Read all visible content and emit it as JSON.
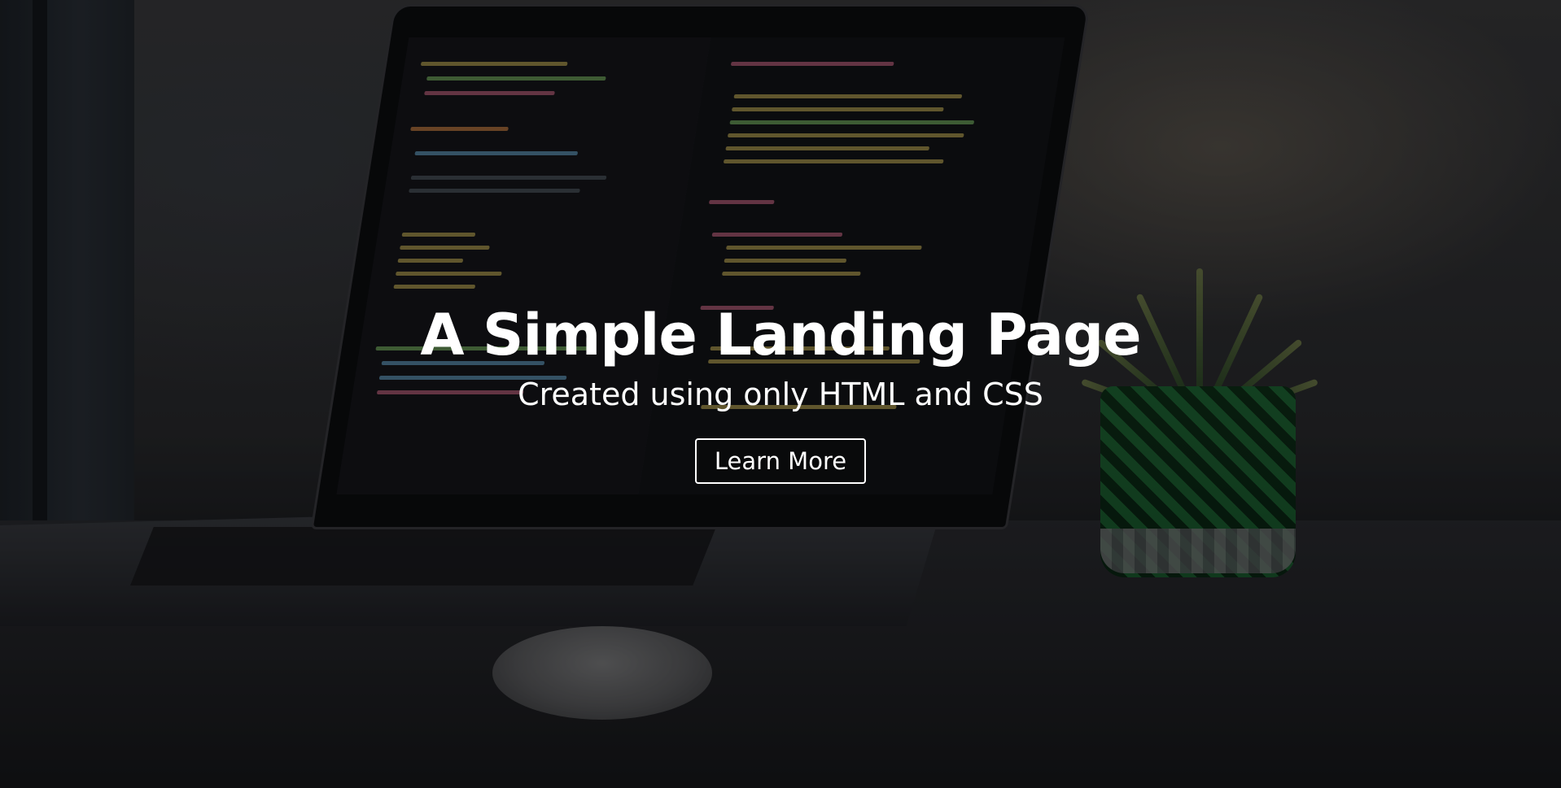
{
  "hero": {
    "title": "A Simple Landing Page",
    "subtitle": "Created using only HTML and CSS",
    "cta_label": "Learn More"
  },
  "colors": {
    "text": "#ffffff",
    "button_border": "#ffffff",
    "overlay": "rgba(0,0,0,0.38)"
  }
}
